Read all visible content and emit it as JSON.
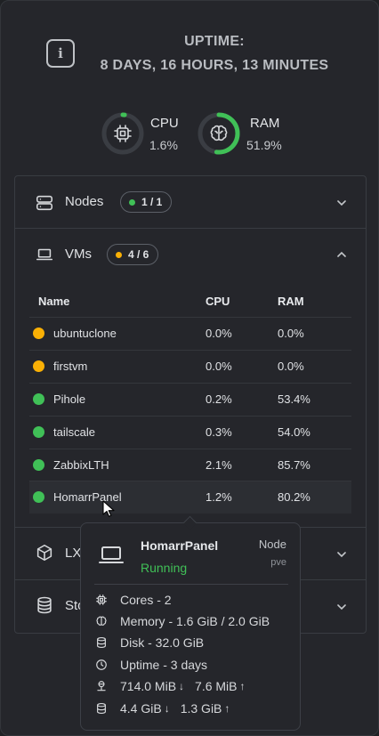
{
  "header": {
    "uptime_label": "UPTIME:",
    "uptime_value": "8 DAYS, 16 HOURS, 13 MINUTES",
    "info_icon": "info-icon"
  },
  "gauges": {
    "cpu": {
      "label": "CPU",
      "value": "1.6%",
      "percent": 1.6,
      "color": "#40c057"
    },
    "ram": {
      "label": "RAM",
      "value": "51.9%",
      "percent": 51.9,
      "color": "#40c057"
    }
  },
  "sections": {
    "nodes": {
      "label": "Nodes",
      "badge": "1 / 1",
      "badge_color": "#40c057",
      "icon": "server-icon",
      "expanded": false
    },
    "vms": {
      "label": "VMs",
      "badge": "4 / 6",
      "badge_color": "#fab005",
      "icon": "laptop-icon",
      "expanded": true
    },
    "lxc": {
      "label": "LX",
      "icon": "cube-icon",
      "expanded": false
    },
    "storage": {
      "label": "Sto",
      "icon": "database-icon",
      "expanded": false
    }
  },
  "vm_table": {
    "columns": [
      "Name",
      "CPU",
      "RAM"
    ],
    "rows": [
      {
        "name": "ubuntuclone",
        "cpu": "0.0%",
        "ram": "0.0%",
        "status_color": "#fab005"
      },
      {
        "name": "firstvm",
        "cpu": "0.0%",
        "ram": "0.0%",
        "status_color": "#fab005"
      },
      {
        "name": "Pihole",
        "cpu": "0.2%",
        "ram": "53.4%",
        "status_color": "#40c057"
      },
      {
        "name": "tailscale",
        "cpu": "0.3%",
        "ram": "54.0%",
        "status_color": "#40c057"
      },
      {
        "name": "ZabbixLTH",
        "cpu": "2.1%",
        "ram": "85.7%",
        "status_color": "#40c057"
      },
      {
        "name": "HomarrPanel",
        "cpu": "1.2%",
        "ram": "80.2%",
        "status_color": "#40c057"
      }
    ]
  },
  "tooltip": {
    "title": "HomarrPanel",
    "status": "Running",
    "node_label": "Node",
    "node_name": "pve",
    "cores": "Cores - 2",
    "memory": "Memory - 1.6 GiB / 2.0 GiB",
    "disk": "Disk - 32.0 GiB",
    "uptime": "Uptime - 3 days",
    "net_in": "714.0 MiB",
    "net_out": "7.6 MiB",
    "disk_read": "4.4 GiB",
    "disk_write": "1.3 GiB"
  }
}
